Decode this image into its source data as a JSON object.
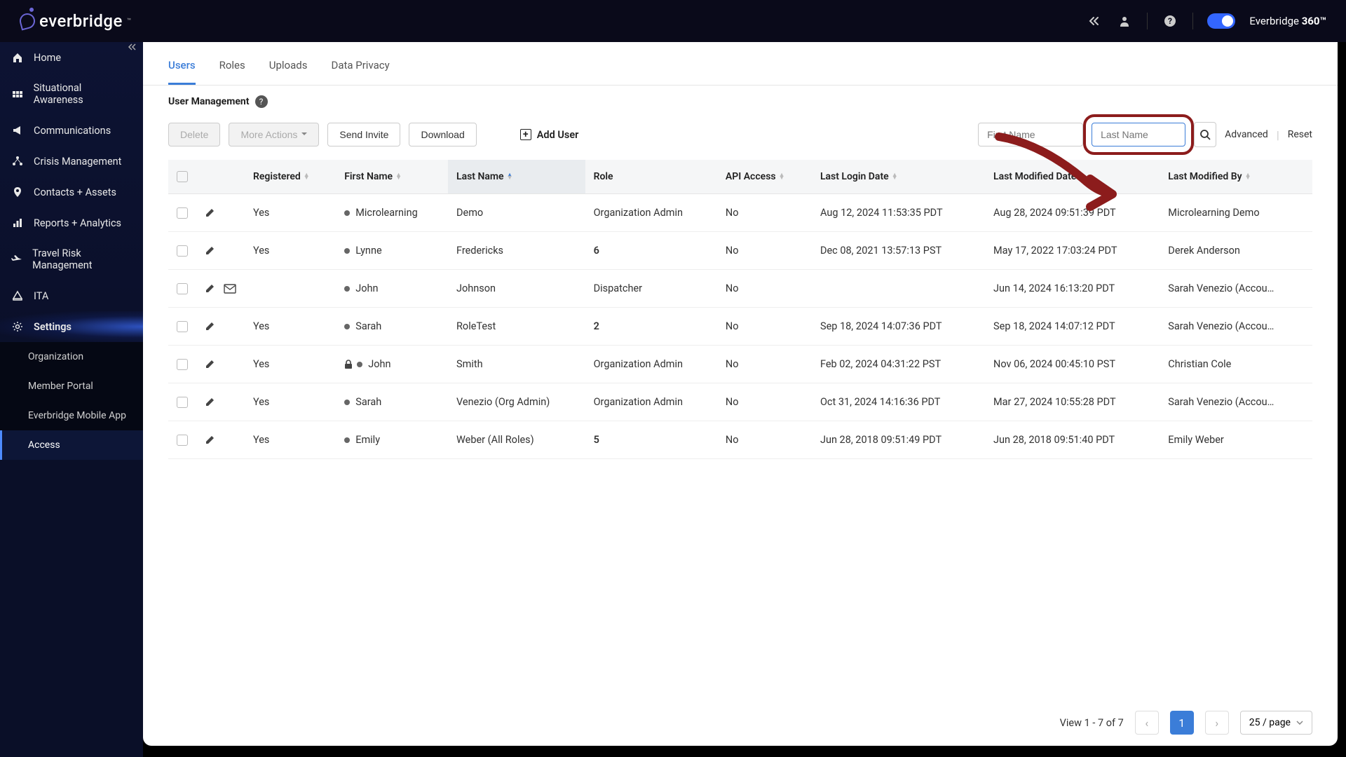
{
  "brand": {
    "name": "everbridge",
    "toggle_label": "Everbridge",
    "toggle_bold": "360™"
  },
  "sidebar": {
    "items": [
      {
        "label": "Home"
      },
      {
        "label": "Situational Awareness"
      },
      {
        "label": "Communications"
      },
      {
        "label": "Crisis Management"
      },
      {
        "label": "Contacts + Assets"
      },
      {
        "label": "Reports + Analytics"
      },
      {
        "label": "Travel Risk Management"
      },
      {
        "label": "ITA"
      },
      {
        "label": "Settings"
      }
    ],
    "subitems": [
      {
        "label": "Organization"
      },
      {
        "label": "Member Portal"
      },
      {
        "label": "Everbridge Mobile App"
      },
      {
        "label": "Access"
      }
    ]
  },
  "tabs": [
    {
      "label": "Users",
      "active": true
    },
    {
      "label": "Roles"
    },
    {
      "label": "Uploads"
    },
    {
      "label": "Data Privacy"
    }
  ],
  "page": {
    "title": "User Management"
  },
  "toolbar": {
    "delete": "Delete",
    "more_actions": "More Actions",
    "send_invite": "Send Invite",
    "download": "Download",
    "add_user": "Add User",
    "first_name_placeholder": "First Name",
    "last_name_placeholder": "Last Name",
    "advanced": "Advanced",
    "reset": "Reset"
  },
  "columns": {
    "registered": "Registered",
    "first_name": "First Name",
    "last_name": "Last Name",
    "role": "Role",
    "api_access": "API Access",
    "last_login": "Last Login Date",
    "last_modified": "Last Modified Date",
    "last_modified_by": "Last Modified By"
  },
  "rows": [
    {
      "registered": "Yes",
      "first_name": "Microlearning",
      "last_name": "Demo",
      "role": "Organization Admin",
      "role_bold": false,
      "api": "No",
      "login": "Aug 12, 2024 11:53:35 PDT",
      "modified": "Aug 28, 2024 09:51:39 PDT",
      "by": "Microlearning Demo",
      "has_mail": false,
      "locked": false
    },
    {
      "registered": "Yes",
      "first_name": "Lynne",
      "last_name": "Fredericks",
      "role": "6",
      "role_bold": true,
      "api": "No",
      "login": "Dec 08, 2021 13:57:13 PST",
      "modified": "May 17, 2022 17:03:24 PDT",
      "by": "Derek Anderson",
      "has_mail": false,
      "locked": false
    },
    {
      "registered": "",
      "first_name": "John",
      "last_name": "Johnson",
      "role": "Dispatcher",
      "role_bold": false,
      "api": "No",
      "login": "",
      "modified": "Jun 14, 2024 16:13:20 PDT",
      "by": "Sarah Venezio (Accou…",
      "has_mail": true,
      "locked": false
    },
    {
      "registered": "Yes",
      "first_name": "Sarah",
      "last_name": "RoleTest",
      "role": "2",
      "role_bold": true,
      "api": "No",
      "login": "Sep 18, 2024 14:07:36 PDT",
      "modified": "Sep 18, 2024 14:07:12 PDT",
      "by": "Sarah Venezio (Accou…",
      "has_mail": false,
      "locked": false
    },
    {
      "registered": "Yes",
      "first_name": "John",
      "last_name": "Smith",
      "role": "Organization Admin",
      "role_bold": false,
      "api": "No",
      "login": "Feb 02, 2024 04:31:22 PST",
      "modified": "Nov 06, 2024 00:45:10 PST",
      "by": "Christian Cole",
      "has_mail": false,
      "locked": true
    },
    {
      "registered": "Yes",
      "first_name": "Sarah",
      "last_name": "Venezio (Org Admin)",
      "role": "Organization Admin",
      "role_bold": false,
      "api": "No",
      "login": "Oct 31, 2024 14:16:36 PDT",
      "modified": "Mar 27, 2024 10:55:28 PDT",
      "by": "Sarah Venezio (Accou…",
      "has_mail": false,
      "locked": false
    },
    {
      "registered": "Yes",
      "first_name": "Emily",
      "last_name": "Weber (All Roles)",
      "role": "5",
      "role_bold": true,
      "api": "No",
      "login": "Jun 28, 2018 09:51:49 PDT",
      "modified": "Jun 28, 2018 09:51:40 PDT",
      "by": "Emily Weber",
      "has_mail": false,
      "locked": false
    }
  ],
  "pagination": {
    "info": "View 1 - 7 of 7",
    "current": "1",
    "page_size": "25 / page"
  }
}
